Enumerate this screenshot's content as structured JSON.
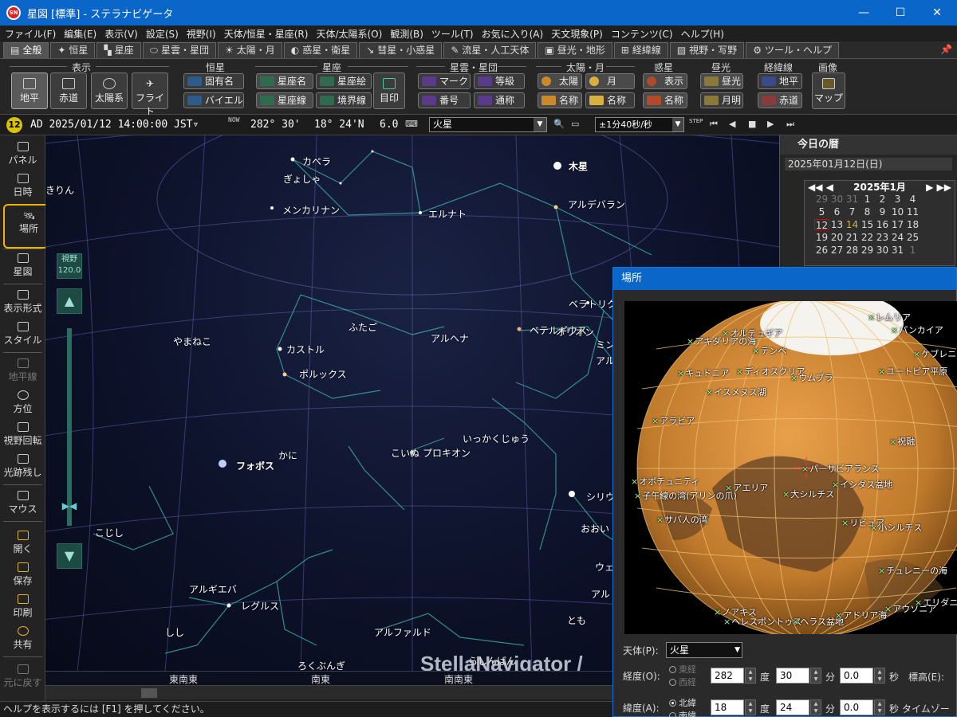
{
  "window": {
    "title": "星図 [標準] - ステラナビゲータ",
    "app_icon_text": "SN"
  },
  "menu": [
    "ファイル(F)",
    "編集(E)",
    "表示(V)",
    "設定(S)",
    "視野(I)",
    "天体/恒星・星座(R)",
    "天体/太陽系(O)",
    "観測(B)",
    "ツール(T)",
    "お気に入り(A)",
    "天文現象(P)",
    "コンテンツ(C)",
    "ヘルプ(H)"
  ],
  "tabs": [
    {
      "icon": "▤",
      "label": "全般"
    },
    {
      "icon": "✦",
      "label": "恒星"
    },
    {
      "icon": "▚",
      "label": "星座"
    },
    {
      "icon": "⬭",
      "label": "星雲・星団"
    },
    {
      "icon": "☀",
      "label": "太陽・月"
    },
    {
      "icon": "◐",
      "label": "惑星・衛星"
    },
    {
      "icon": "↘",
      "label": "彗星・小惑星"
    },
    {
      "icon": "✎",
      "label": "流星・人工天体"
    },
    {
      "icon": "▣",
      "label": "昼光・地形"
    },
    {
      "icon": "⊞",
      "label": "経緯線"
    },
    {
      "icon": "▧",
      "label": "視野・写野"
    },
    {
      "icon": "⚙",
      "label": "ツール・ヘルプ"
    }
  ],
  "ribbon": {
    "groups": {
      "display": "表示",
      "star": "恒星",
      "constellation": "星座",
      "nebula": "星雲・星団",
      "sunmoon": "太陽・月",
      "planet": "惑星",
      "daylight": "昼光",
      "grid": "経緯線",
      "image": "画像"
    },
    "display_buttons": [
      "地平",
      "赤道",
      "太陽系",
      "フライト"
    ],
    "star_buttons": [
      "固有名",
      "バイエル"
    ],
    "const_buttons": [
      "星座名",
      "星座絵",
      "星座線",
      "境界線"
    ],
    "const_big": "目印",
    "nebula_buttons": [
      "マーク",
      "等級",
      "番号",
      "通称"
    ],
    "sunmoon_buttons": [
      "太陽",
      "月",
      "名称",
      "名称"
    ],
    "planet_buttons": [
      "表示",
      "名称"
    ],
    "daylight_buttons": [
      "昼光",
      "月明"
    ],
    "grid_buttons": [
      "地平",
      "赤道"
    ],
    "image_button": "マップ"
  },
  "toolbar": {
    "badge": "12",
    "datetime": "AD 2025/01/12 14:00:00 JST▿",
    "now_label": "NOW",
    "longitude": "282° 30'",
    "latitude": "18° 24'N",
    "magnitude": "6.0",
    "object": "火星",
    "speed": "±1分40秒/秒",
    "step_label": "STEP"
  },
  "left_toolbar": [
    "パネル",
    "日時",
    "場所",
    "星図",
    "表示形式",
    "スタイル",
    "地平線",
    "方位",
    "視野回転",
    "光跡残し",
    "マウス",
    "開く",
    "保存",
    "印刷",
    "共有",
    "元に戻す"
  ],
  "fov": {
    "label": "視野",
    "value": "120.0"
  },
  "sky_labels": [
    "カペラ",
    "ぎょしゃ",
    "メンカリナン",
    "エルナト",
    "木星",
    "アルデバラン",
    "きりん",
    "ベテルギウス",
    "オリオン",
    "ベラトリクス",
    "ミン",
    "アル",
    "ふたご",
    "カストル",
    "アルヘナ",
    "やまねこ",
    "ポルックス",
    "かに",
    "フォボス",
    "こいぬ",
    "プロキオン",
    "いっかくじゅう",
    "シリウ",
    "おおい",
    "こじし",
    "アルギエバ",
    "レグルス",
    "ウェ",
    "アルド",
    "アルファルド",
    "しし",
    "とも",
    "ろくぶんぎ",
    "らしんばん"
  ],
  "horizon_directions": [
    "東南東",
    "南東",
    "南南東"
  ],
  "watermark": "StellaNavigator /",
  "status_text": "ヘルプを表示するには [F1] を押してください。",
  "calendar": {
    "header": "今日の暦",
    "date": "2025年01月12日(日)",
    "month": "2025年1月",
    "days": [
      [
        "29",
        "30",
        "31",
        "1",
        "2",
        "3",
        "4"
      ],
      [
        "5",
        "6",
        "7",
        "8",
        "9",
        "10",
        "11"
      ],
      [
        "12",
        "13",
        "14",
        "15",
        "16",
        "17",
        "18"
      ],
      [
        "19",
        "20",
        "21",
        "22",
        "23",
        "24",
        "25"
      ],
      [
        "26",
        "27",
        "28",
        "29",
        "30",
        "31",
        "1"
      ]
    ]
  },
  "location_dialog": {
    "title": "場所",
    "map_labels": [
      "レムリア",
      "オルテュギア",
      "パンカイア",
      "アキダリアの海",
      "ケブレニア",
      "テンペ",
      "キュドニア",
      "ディオスクリア",
      "ユートピア平原",
      "ウムブラ",
      "イスメヌス湖",
      "アラビア",
      "祝融",
      "パーサビアランス",
      "オポチュニティ",
      "アエリア",
      "イシダス盆地",
      "子午線の湾(アリンの爪)",
      "大シルチス",
      "サバ人の湾",
      "リビュア",
      "小シルチス",
      "チュレニーの海",
      "エリダニア",
      "アウソニア",
      "ノアキス",
      "ヘレスポントゥス",
      "ヘラス盆地",
      "アドリア海"
    ],
    "body_label": "天体(P):",
    "body_value": "火星",
    "lon_label": "経度(O):",
    "lat_label": "緯度(A):",
    "east": "東経",
    "west": "西経",
    "north": "北緯",
    "south": "南緯",
    "lon_deg": "282",
    "lon_min": "30",
    "lon_sec": "0.0",
    "lat_deg": "18",
    "lat_min": "24",
    "lat_sec": "0.0",
    "deg_unit": "度",
    "min_unit": "分",
    "sec_unit": "秒",
    "alt_label": "標高(E):",
    "tz_label": "タイムゾーン"
  }
}
